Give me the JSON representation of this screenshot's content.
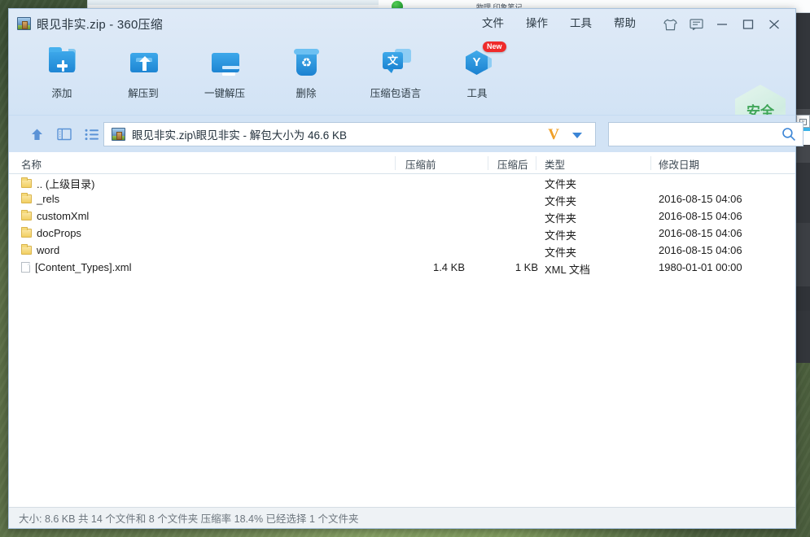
{
  "window": {
    "title": "眼见非实.zip - 360压缩",
    "app_icon": "archive-icon"
  },
  "menubar": {
    "items": [
      {
        "label": "文件",
        "name": "menu-file"
      },
      {
        "label": "操作",
        "name": "menu-actions"
      },
      {
        "label": "工具",
        "name": "menu-tools"
      },
      {
        "label": "帮助",
        "name": "menu-help"
      }
    ]
  },
  "window_controls": {
    "skin": "skin-icon",
    "feedback": "feedback-icon",
    "minimize": "minimize-icon",
    "maximize": "maximize-icon",
    "close": "close-icon"
  },
  "toolbar": {
    "buttons": [
      {
        "label": "添加",
        "icon": "folder-add-icon"
      },
      {
        "label": "解压到",
        "icon": "folder-extract-icon"
      },
      {
        "label": "一键解压",
        "icon": "one-click-extract-icon"
      },
      {
        "label": "删除",
        "icon": "delete-trash-icon"
      },
      {
        "label": "压缩包语言",
        "icon": "translate-icon"
      },
      {
        "label": "工具",
        "icon": "tools-hex-icon",
        "badge": "New"
      }
    ],
    "safety_badge": "安全"
  },
  "addressbar": {
    "up_icon": "up-arrow-icon",
    "view_icon": "panel-view-icon",
    "list_icon": "list-view-icon",
    "path": "眼见非实.zip\\眼见非实 - 解包大小为 46.6 KB",
    "verify_mark": "V",
    "dropdown_icon": "chevron-down-icon",
    "search_value": "",
    "search_placeholder": "",
    "search_icon": "search-icon"
  },
  "filelist": {
    "columns": [
      {
        "label": "名称",
        "name": "column-name"
      },
      {
        "label": "压缩前",
        "name": "column-size-before"
      },
      {
        "label": "压缩后",
        "name": "column-size-after"
      },
      {
        "label": "类型",
        "name": "column-type"
      },
      {
        "label": "修改日期",
        "name": "column-modified"
      }
    ],
    "rows": [
      {
        "icon": "folder",
        "name": ".. (上级目录)",
        "before": "",
        "after": "",
        "type": "文件夹",
        "modified": ""
      },
      {
        "icon": "folder",
        "name": "_rels",
        "before": "",
        "after": "",
        "type": "文件夹",
        "modified": "2016-08-15 04:06"
      },
      {
        "icon": "folder",
        "name": "customXml",
        "before": "",
        "after": "",
        "type": "文件夹",
        "modified": "2016-08-15 04:06"
      },
      {
        "icon": "folder",
        "name": "docProps",
        "before": "",
        "after": "",
        "type": "文件夹",
        "modified": "2016-08-15 04:06"
      },
      {
        "icon": "folder",
        "name": "word",
        "before": "",
        "after": "",
        "type": "文件夹",
        "modified": "2016-08-15 04:06"
      },
      {
        "icon": "file",
        "name": "[Content_Types].xml",
        "before": "1.4 KB",
        "after": "1 KB",
        "type": "XML 文档",
        "modified": "1980-01-01 00:00"
      }
    ]
  },
  "statusbar": {
    "text": "大小: 8.6 KB 共 14 个文件和 8 个文件夹 压缩率 18.4% 已经选择 1 个文件夹"
  },
  "background": {
    "other_window_text": "物理    印象笔记"
  },
  "colors": {
    "accent": "#2190db",
    "header_bg": "#d2e3f5",
    "safety_green": "#2f9e49",
    "badge_red": "#ef2b2b",
    "verify_orange": "#f0a028"
  }
}
